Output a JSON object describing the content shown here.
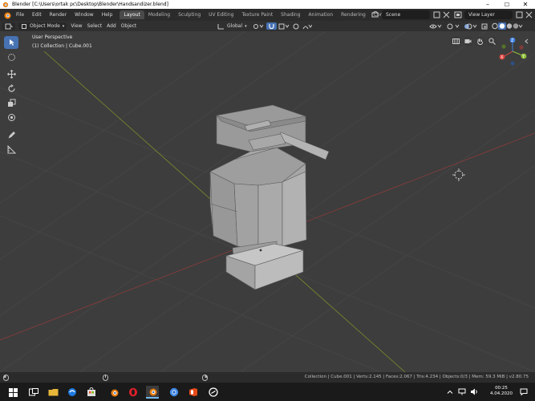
{
  "window": {
    "title": "Blender [C:\\Users\\ortak pc\\Desktop\\Blender\\Handsandizer.blend]",
    "minimize": "–",
    "maximize": "☐",
    "close": "✕"
  },
  "topbar": {
    "menus": [
      "File",
      "Edit",
      "Render",
      "Window",
      "Help"
    ],
    "workspaces": [
      "Layout",
      "Modeling",
      "Sculpting",
      "UV Editing",
      "Texture Paint",
      "Shading",
      "Animation",
      "Rendering",
      "Compositing"
    ],
    "active_workspace": "Layout",
    "scene": "Scene",
    "view_layer": "View Layer"
  },
  "header": {
    "mode": "Object Mode",
    "menus": [
      "View",
      "Select",
      "Add",
      "Object"
    ],
    "transform_orientation": "Global"
  },
  "viewport": {
    "view_name": "User Perspective",
    "collection_info": "(1) Collection | Cube.001",
    "gizmo_axes": [
      "X",
      "Y",
      "Z"
    ]
  },
  "status": {
    "text": "Collection | Cube.001 | Verts:2.145 | Faces:2.067 | Tris:4.234 | Objects:0/3 | Mem: 59.3 MiB | v2.80.75"
  },
  "taskbar": {
    "time": "00:25",
    "date": "4.04.2020"
  },
  "colors": {
    "accent": "#4772b3",
    "viewport_bg": "#3d3d3d",
    "x_axis": "#9b3a3a",
    "y_axis": "#8a9a2a",
    "gizmo_x": "#e0463f",
    "gizmo_y": "#8ec13a",
    "gizmo_z": "#3f7fe0"
  }
}
